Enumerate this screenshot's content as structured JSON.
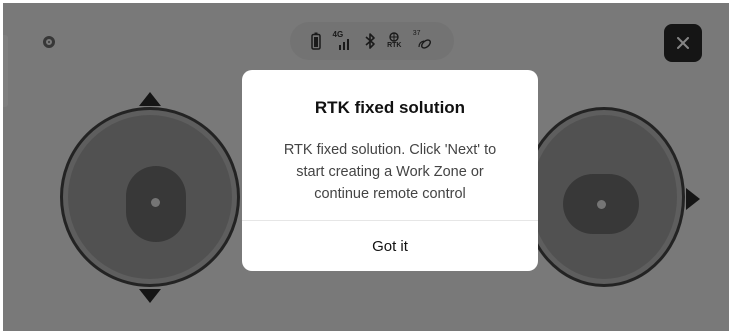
{
  "status_bar": {
    "battery_icon": "battery-icon",
    "network_label": "4G",
    "bluetooth_icon": "bluetooth-icon",
    "rtk_label": "RTK",
    "satellite_count": "37"
  },
  "controls": {
    "record_icon": "record-icon",
    "close_icon": "close-icon",
    "left_joystick": "left-joystick",
    "right_joystick": "right-joystick"
  },
  "dialog": {
    "title": "RTK fixed solution",
    "message": "RTK fixed solution. Click 'Next' to start creating a Work Zone or continue remote control",
    "button_label": "Got it"
  }
}
